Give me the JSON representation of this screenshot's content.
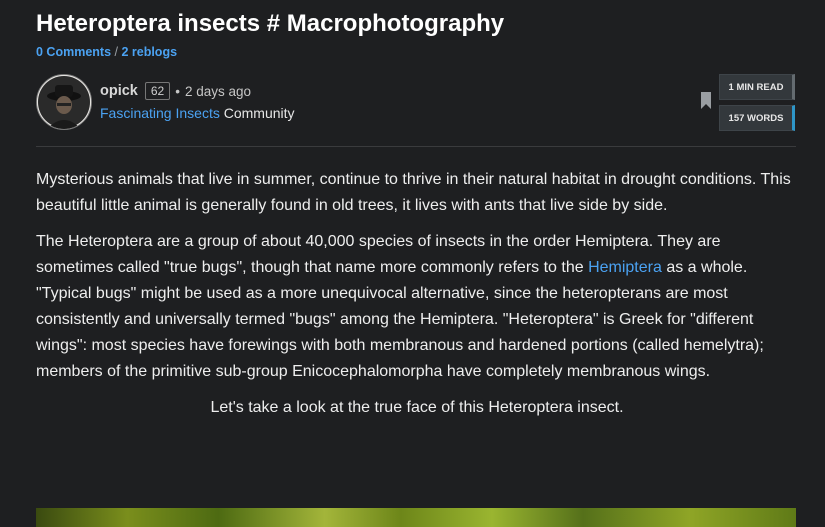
{
  "post": {
    "title": "Heteroptera insects # Macrophotography",
    "comments": "0 Comments",
    "separator": " / ",
    "reblogs": "2 reblogs"
  },
  "author": {
    "name": "opick",
    "reputation": "62",
    "time_sep": "•",
    "time": "2 days ago",
    "community_name": "Fascinating Insects",
    "community_suffix": " Community"
  },
  "stats": {
    "read_time": "1 MIN READ",
    "word_count": "157 WORDS"
  },
  "content": {
    "p1": "Mysterious animals that live in summer, continue to thrive in their natural habitat in drought conditions. This beautiful little animal is generally found in old trees, it lives with ants that live side by side.",
    "p2_before": "The Heteroptera are a group of about 40,000 species of insects in the order Hemiptera. They are sometimes called \"true bugs\", though that name more commonly refers to the ",
    "p2_link": "Hemiptera",
    "p2_after": " as a whole. \"Typical bugs\" might be used as a more unequivocal alternative, since the heteropterans are most consistently and universally termed \"bugs\" among the Hemiptera. \"Heteroptera\" is Greek for \"different wings\": most species have forewings with both membranous and hardened portions (called hemelytra); members of the primitive sub-group Enicocephalomorpha have completely membranous wings.",
    "p3": "Let's take a look at the true face of this Heteroptera insect."
  },
  "colors": {
    "background": "#1e1f21",
    "link": "#4ba2f2",
    "words_accent": "#2e96c8"
  },
  "icons": {
    "bookmark": "bookmark-icon",
    "avatar": "avatar"
  }
}
